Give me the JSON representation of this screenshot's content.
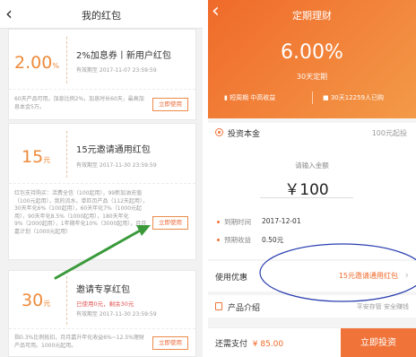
{
  "left": {
    "back": "‹",
    "title": "我的红包",
    "coupons": [
      {
        "amount": "2.00",
        "unit": "%",
        "name": "2%加息券丨新用户红包",
        "valid": "有效期至 2017-11-07 23:59:59",
        "note": "",
        "desc": "60天产品可用。加息比例2%，加息时长60天，最高加息本金5万。",
        "use": "立即使用"
      },
      {
        "amount": "15",
        "unit": "元",
        "name": "15元邀请通用红包",
        "valid": "有效期至 2017-11-30 23:59:59",
        "note": "",
        "desc": "红包支持购买：活费全信（100起用），99新加油充值（100元起用），我的流水，单匹页产品（112天起用），30天年化6%（100起用），60天年化7%（1000元起用），90天年化8.5%（1000起用），180天年化9%（2000起用），1年期年化10%（3000起用），月月嘉计划（1000元起用）",
        "use": "立即使用"
      },
      {
        "amount": "30",
        "unit": "元",
        "name": "邀请专享红包",
        "valid": "有效期至 2017-11-30 23:59:59",
        "note": "已使用0元，剩余30元",
        "desc": "指0.3%比例抵扣，月月嘉升年化收益6%~12.5%理财产品可用。1000元起用。",
        "use": "立即使用"
      }
    ]
  },
  "right": {
    "back": "‹",
    "title": "定期理财",
    "rate": "6.00%",
    "period": "30天定期",
    "tag_left": "短周期 中高收益",
    "tag_right": "30天12259人已购",
    "principal_label": "投资本金",
    "principal_min": "100元起投",
    "input_hint": "请输入金额",
    "input_value": "￥100",
    "due_label": "到期时间",
    "due_value": "2017-12-01",
    "income_label": "预期收益",
    "income_value": "0.50元",
    "coupon_label": "使用优惠",
    "coupon_value": "15元邀请通用红包",
    "product_label": "产品介绍",
    "product_value": "平安存管 安全赚钱",
    "pay_label": "还需支付",
    "pay_amount": "¥ 85.00",
    "pay_button": "立即投资"
  },
  "colors": {
    "accent": "#f0743a",
    "coupon_orange": "#ee8a3a",
    "arrow_green": "#3a9a3a",
    "ellipse_blue": "#2a3fb0"
  }
}
